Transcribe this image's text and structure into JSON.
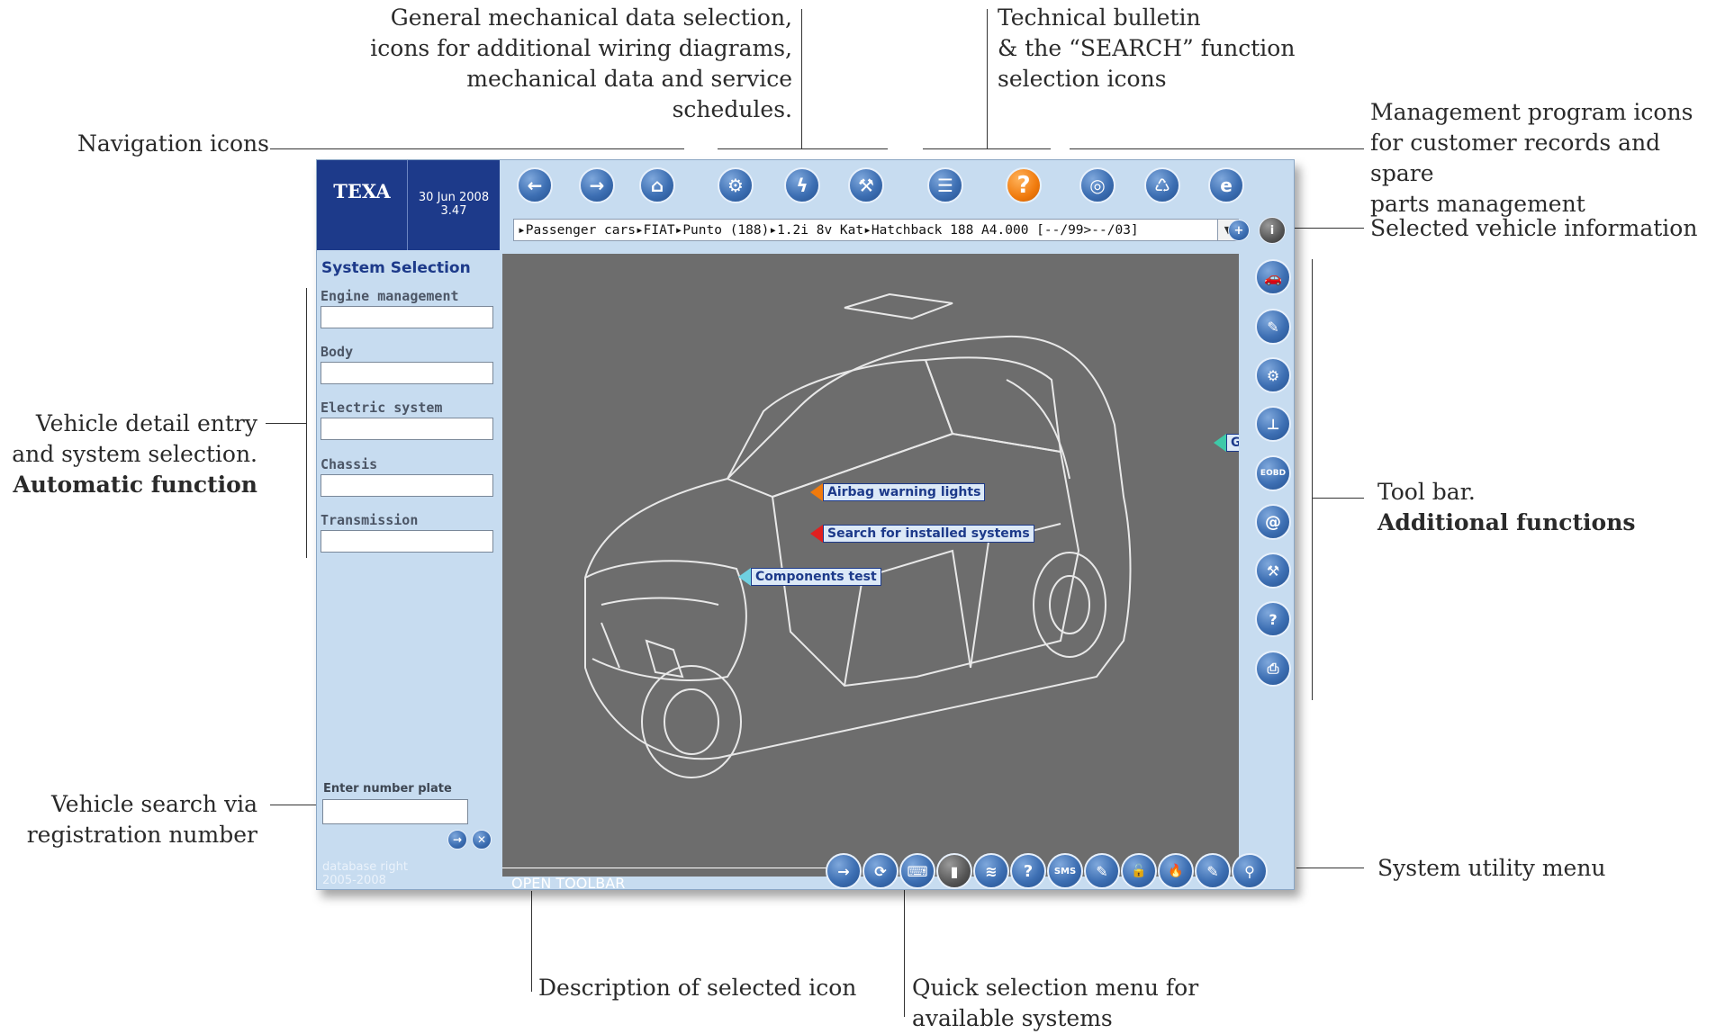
{
  "callouts": {
    "general_mech": "General mechanical data selection,\nicons for additional wiring diagrams,\nmechanical data and service schedules.",
    "tech_bulletin": "Technical bulletin\n& the “SEARCH” function\nselection icons",
    "management": "Management program icons\nfor customer records and spare\nparts management",
    "navigation": "Navigation icons",
    "selected_vehicle": "Selected vehicle information",
    "vehicle_detail_1": "Vehicle detail entry",
    "vehicle_detail_2": "and system selection.",
    "vehicle_detail_3": "Automatic function",
    "tool_bar_1": "Tool bar.",
    "tool_bar_2": "Additional functions",
    "vehicle_search_1": "Vehicle search via",
    "vehicle_search_2": "registration number",
    "system_utility": "System utility menu",
    "description_selected": "Description of selected icon",
    "quick_selection": "Quick selection menu for\navailable systems"
  },
  "app": {
    "brand": "TEXA",
    "date": "30 Jun 2008",
    "time": "3.47",
    "vehicle_path": "▸Passenger cars▸FIAT▸Punto (188)▸1.2i 8v Kat▸Hatchback 188 A4.000 [--/99>--/03]",
    "dropdown_arrow": "▼",
    "sidebar": {
      "title": "System Selection",
      "systems": [
        "Engine management",
        "Body",
        "Electric system",
        "Chassis",
        "Transmission"
      ],
      "plate_label": "Enter number plate",
      "database_rights": "database right\n2005-2008"
    },
    "status_text": "OPEN TOOLBAR",
    "hotspots": {
      "airbag": "Airbag warning lights",
      "search_installed": "Search for installed systems",
      "components_test": "Components test",
      "partial": "G"
    },
    "bottom_toolbar": [
      "→",
      "⟳",
      "⌨",
      "▮",
      "≋",
      "?",
      "SMS",
      "✎",
      "🔓",
      "🔥",
      "✎",
      "⚲"
    ],
    "right_toolbar": [
      "🚗",
      "✎",
      "⚙",
      "⊥",
      "EOBD",
      "@",
      "⚒",
      "?",
      "⎙"
    ],
    "colors": {
      "panel": "#c7dcf0",
      "brand_bg": "#1d3a8a",
      "viewport": "#6d6d6d",
      "accent_orange": "#f07a0c"
    }
  }
}
